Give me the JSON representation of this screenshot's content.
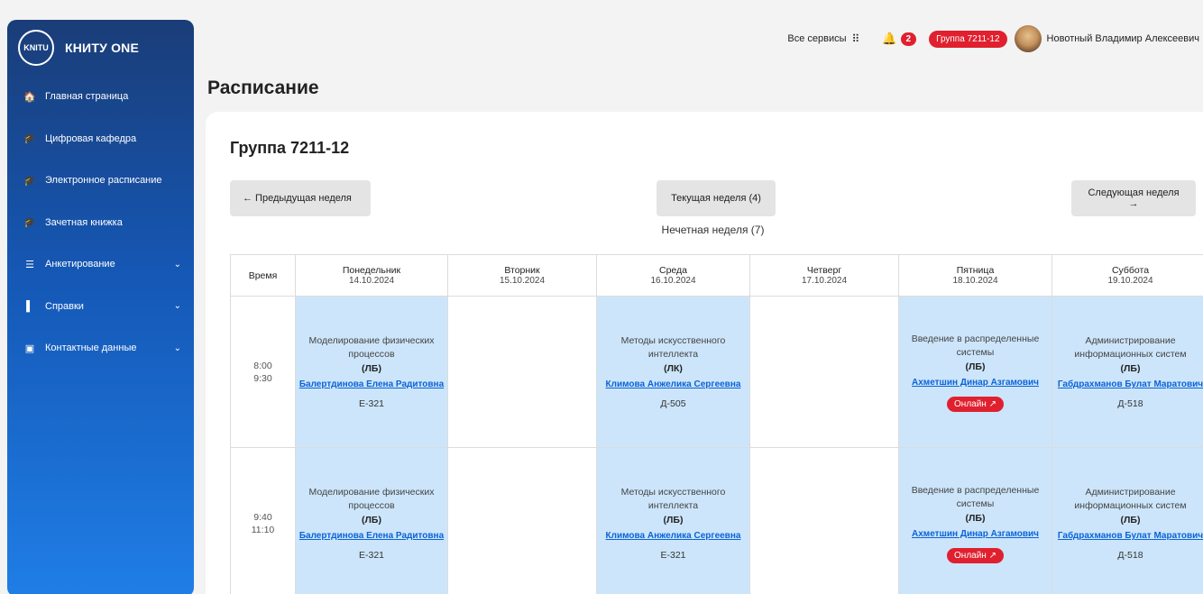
{
  "sidebar": {
    "logo_text": "КНИТУ ONE",
    "items": [
      {
        "label": "Главная страница",
        "icon": "home-icon",
        "glyph": "🏠"
      },
      {
        "label": "Цифровая кафедра",
        "icon": "graduation-cap-icon",
        "glyph": "🎓"
      },
      {
        "label": "Электронное расписание",
        "icon": "graduation-cap-icon",
        "glyph": "🎓"
      },
      {
        "label": "Зачетная книжка",
        "icon": "graduation-cap-icon",
        "glyph": "🎓"
      },
      {
        "label": "Анкетирование",
        "icon": "list-icon",
        "glyph": "☰",
        "chevron": "⌄"
      },
      {
        "label": "Справки",
        "icon": "file-icon",
        "glyph": "▌",
        "chevron": "⌄"
      },
      {
        "label": "Контактные данные",
        "icon": "contact-card-icon",
        "glyph": "▣",
        "chevron": "⌄"
      }
    ]
  },
  "header": {
    "services_label": "Все сервисы",
    "services_icon": "grid-icon",
    "notifications_count": "2",
    "group_badge": "Группа 7211-12",
    "user_name": "Новотный Владимир Алексеевич"
  },
  "page": {
    "title": "Расписание",
    "group_title": "Группа 7211-12",
    "prev_week": "← Предыдущая неделя",
    "current_week": "Текущая неделя (4)",
    "next_week": "Следующая неделя →",
    "week_parity": "Нечетная неделя (7)"
  },
  "table": {
    "time_header": "Время",
    "days": [
      {
        "name": "Понедельник",
        "date": "14.10.2024"
      },
      {
        "name": "Вторник",
        "date": "15.10.2024"
      },
      {
        "name": "Среда",
        "date": "16.10.2024"
      },
      {
        "name": "Четверг",
        "date": "17.10.2024"
      },
      {
        "name": "Пятница",
        "date": "18.10.2024"
      },
      {
        "name": "Суббота",
        "date": "19.10.2024"
      }
    ],
    "rows": [
      {
        "start": "8:00",
        "end": "9:30",
        "cells": [
          {
            "subject": "Моделирование физических процессов",
            "type": "(ЛБ)",
            "teacher": "Балертдинова Елена Радитовна",
            "room": "Е-321"
          },
          null,
          {
            "subject": "Методы искусственного интеллекта",
            "type": "(ЛК)",
            "teacher": "Климова Анжелика Сергеевна",
            "room": "Д-505"
          },
          null,
          {
            "subject": "Введение в распределенные системы",
            "type": "(ЛБ)",
            "teacher": "Ахметшин Динар Азгамович",
            "online": "Онлайн ↗"
          },
          {
            "subject": "Администрирование информационных систем",
            "type": "(ЛБ)",
            "teacher": "Габдрахманов Булат Маратович",
            "room": "Д-518"
          }
        ]
      },
      {
        "start": "9:40",
        "end": "11:10",
        "cells": [
          {
            "subject": "Моделирование физических процессов",
            "type": "(ЛБ)",
            "teacher": "Балертдинова Елена Радитовна",
            "room": "Е-321"
          },
          null,
          {
            "subject": "Методы искусственного интеллекта",
            "type": "(ЛБ)",
            "teacher": "Климова Анжелика Сергеевна",
            "room": "Е-321"
          },
          null,
          {
            "subject": "Введение в распределенные системы",
            "type": "(ЛБ)",
            "teacher": "Ахметшин Динар Азгамович",
            "online": "Онлайн ↗"
          },
          {
            "subject": "Администрирование информационных систем",
            "type": "(ЛБ)",
            "teacher": "Габдрахманов Булат Маратович",
            "room": "Д-518"
          }
        ]
      }
    ]
  }
}
